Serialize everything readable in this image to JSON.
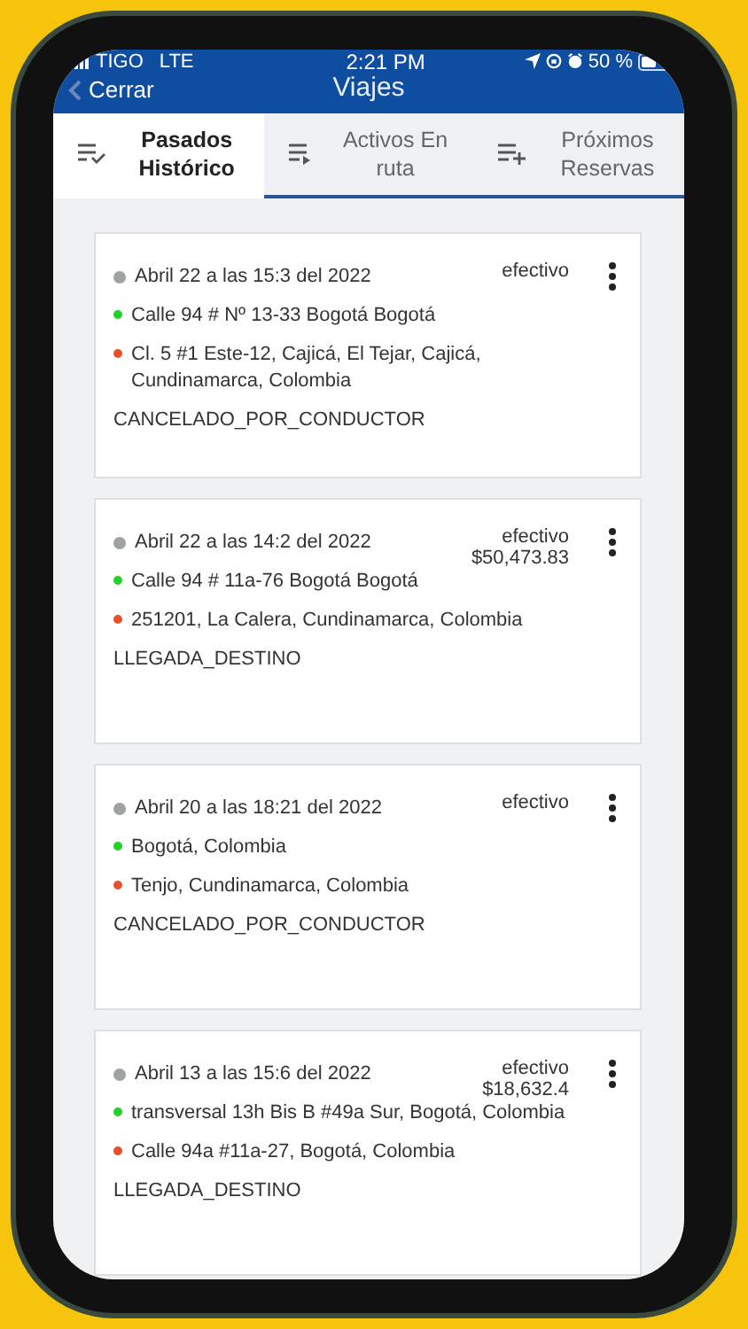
{
  "status_bar": {
    "carrier": "TIGO",
    "network": "LTE",
    "time": "2:21 PM",
    "battery": "50 %"
  },
  "header": {
    "back_label": "Cerrar",
    "title": "Viajes"
  },
  "tabs": [
    {
      "label": "Pasados Histórico",
      "kind": "done",
      "selected": true
    },
    {
      "label": "Activos En ruta",
      "kind": "play",
      "selected": false
    },
    {
      "label": "Próximos Reservas",
      "kind": "add",
      "selected": false
    }
  ],
  "trips": [
    {
      "date": "Abril 22 a las 15:3 del 2022",
      "payment": "efectivo",
      "origin": "Calle 94 # Nº 13-33 Bogotá Bogotá",
      "destination": "Cl. 5 #1 Este-12, Cajicá, El Tejar, Cajicá, Cundinamarca, Colombia",
      "status": "CANCELADO_POR_CONDUCTOR"
    },
    {
      "date": "Abril 22 a las 14:2 del 2022",
      "payment": "efectivo",
      "amount": "$50,473.83",
      "origin": "Calle 94 # 11a-76 Bogotá Bogotá",
      "destination": "251201, La Calera, Cundinamarca, Colombia",
      "status": "LLEGADA_DESTINO"
    },
    {
      "date": "Abril 20 a las 18:21 del 2022",
      "payment": "efectivo",
      "origin": "Bogotá, Colombia",
      "destination": "Tenjo, Cundinamarca, Colombia",
      "status": "CANCELADO_POR_CONDUCTOR"
    },
    {
      "date": "Abril 13 a las 15:6 del 2022",
      "payment": "efectivo",
      "amount": "$18,632.4",
      "origin": "transversal 13h Bis B #49a Sur, Bogotá, Colombia",
      "destination": "Calle 94a #11a-27, Bogotá, Colombia",
      "status": "LLEGADA_DESTINO"
    }
  ]
}
